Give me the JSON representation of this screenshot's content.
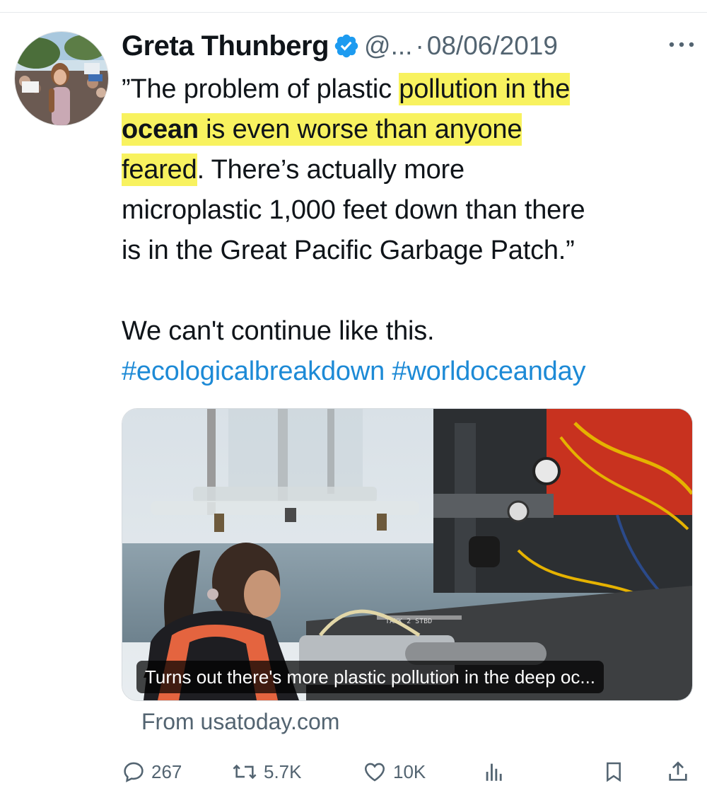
{
  "tweet": {
    "author_name": "Greta Thunberg",
    "handle": "@...",
    "separator": "·",
    "date": "08/06/2019",
    "avatar_icon": "profile-photo",
    "verified_icon": "verified-badge-icon",
    "more_icon": "more-icon",
    "text": {
      "l1_plain": "”The problem of plastic ",
      "l1_hl": "pollution in the",
      "l2_bold": "ocean",
      "l2_hl": " is even worse than anyone",
      "l3_hl": "feared",
      "l3_rest": ". There’s actually more",
      "l4": "microplastic 1,000 feet down than there",
      "l5": "is in the Great Pacific Garbage Patch.”",
      "l6": "We can't continue like this.",
      "hashtags": "#ecologicalbreakdown #worldoceanday"
    },
    "media": {
      "caption": "Turns out there's more plastic pollution in the deep oc...",
      "equipment_label": "TANK 2 STBD"
    },
    "source": "From usatoday.com",
    "actions": {
      "replies": "267",
      "retweets": "5.7K",
      "likes": "10K"
    }
  },
  "colors": {
    "highlight": "#f8f25f",
    "hashtag": "#1d8ad6",
    "verified": "#1d9bf0",
    "muted": "#536471"
  }
}
